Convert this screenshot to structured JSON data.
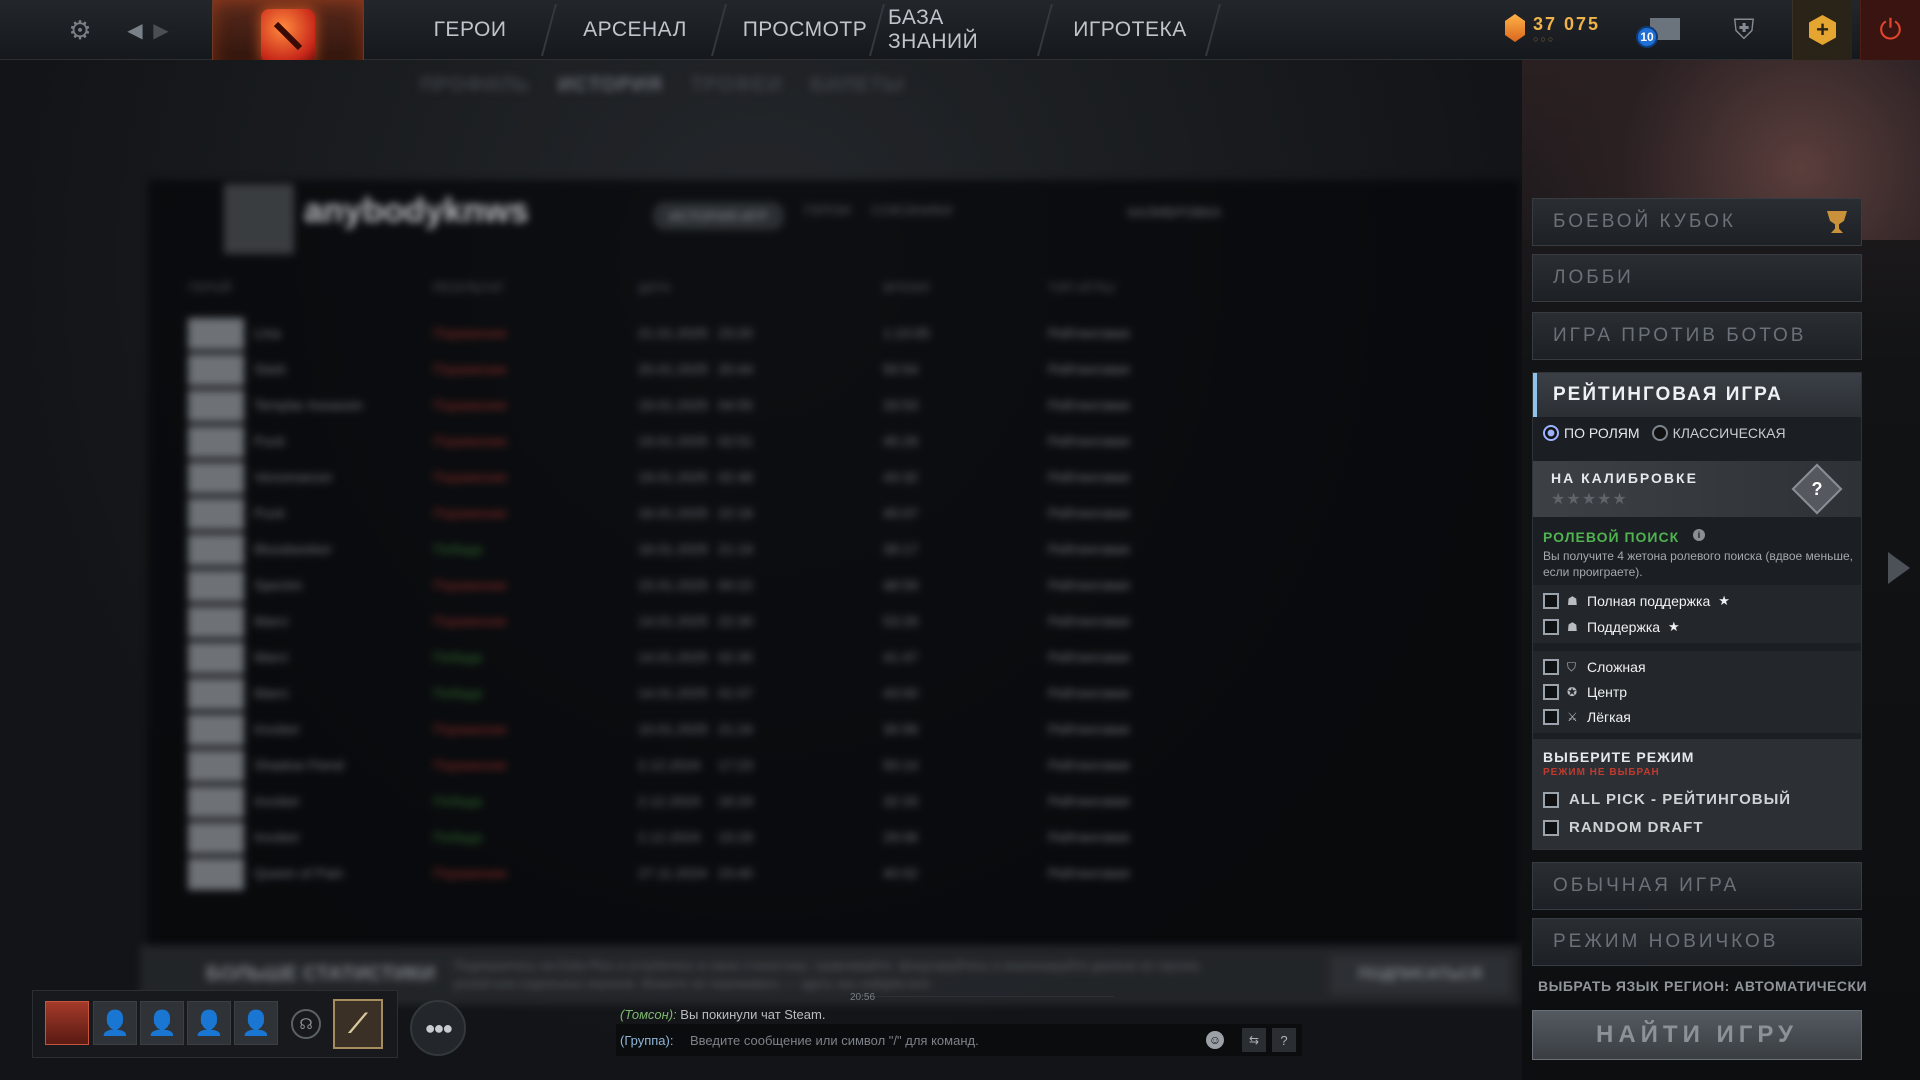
{
  "nav": {
    "heroes": "ГЕРОИ",
    "arsenal": "АРСЕНАЛ",
    "view": "ПРОСМОТР",
    "knowledge": "БАЗА ЗНАНИЙ",
    "arcade": "ИГРОТЕКА"
  },
  "currency": {
    "amount": "37 075",
    "dots": "○○○"
  },
  "mail": {
    "count": "10"
  },
  "profile": {
    "subnav": [
      "ПРОФИЛЬ",
      "ИСТОРИЯ",
      "ТРОФЕИ",
      "БИЛЕТЫ"
    ],
    "name": "anybodyknws",
    "tabs": [
      "ИСТОРИЯ ИГР",
      "ГЕРОИ",
      "СОЮЗНИКИ"
    ],
    "calibration_label": "КАЛИБРОВКА",
    "columns": [
      "ГЕРОЙ",
      "РЕЗУЛЬТАТ",
      "ДАТА",
      "ВРЕМЯ",
      "ТИП ИГРЫ"
    ],
    "matches": [
      {
        "hero": "Lina",
        "result": "Поражение",
        "date": "21.01.2025",
        "time": "23:20",
        "duration": "1:10:05",
        "type": "Рейтинговая",
        "win": false
      },
      {
        "hero": "Slark",
        "result": "Поражение",
        "date": "20.01.2025",
        "time": "20:44",
        "duration": "50:54",
        "type": "Рейтинговая",
        "win": false
      },
      {
        "hero": "Templar Assassin",
        "result": "Поражение",
        "date": "19.01.2025",
        "time": "04:55",
        "duration": "33:53",
        "type": "Рейтинговая",
        "win": false
      },
      {
        "hero": "Puck",
        "result": "Поражение",
        "date": "19.01.2025",
        "time": "02:51",
        "duration": "45:29",
        "type": "Рейтинговая",
        "win": false
      },
      {
        "hero": "Venomancer",
        "result": "Поражение",
        "date": "19.01.2025",
        "time": "02:48",
        "duration": "43:32",
        "type": "Рейтинговая",
        "win": false
      },
      {
        "hero": "Puck",
        "result": "Поражение",
        "date": "16.01.2025",
        "time": "22:16",
        "duration": "45:07",
        "type": "Рейтинговая",
        "win": false
      },
      {
        "hero": "Bloodseeker",
        "result": "Победа",
        "date": "16.01.2025",
        "time": "21:19",
        "duration": "39:17",
        "type": "Рейтинговая",
        "win": true
      },
      {
        "hero": "Spectre",
        "result": "Поражение",
        "date": "15.01.2025",
        "time": "00:22",
        "duration": "48:59",
        "type": "Рейтинговая",
        "win": false
      },
      {
        "hero": "Marci",
        "result": "Поражение",
        "date": "14.01.2025",
        "time": "22:30",
        "duration": "53:29",
        "type": "Рейтинговая",
        "win": false
      },
      {
        "hero": "Marci",
        "result": "Победа",
        "date": "14.01.2025",
        "time": "02:35",
        "duration": "41:47",
        "type": "Рейтинговая",
        "win": true
      },
      {
        "hero": "Marci",
        "result": "Победа",
        "date": "14.01.2025",
        "time": "01:07",
        "duration": "43:00",
        "type": "Рейтинговая",
        "win": true
      },
      {
        "hero": "Invoker",
        "result": "Поражение",
        "date": "10.01.2025",
        "time": "21:24",
        "duration": "30:56",
        "type": "Рейтинговая",
        "win": false
      },
      {
        "hero": "Shadow Fiend",
        "result": "Поражение",
        "date": "2.12.2024",
        "time": "17:23",
        "duration": "50:14",
        "type": "Рейтинговая",
        "win": false
      },
      {
        "hero": "Invoker",
        "result": "Победа",
        "date": "2.12.2024",
        "time": "16:24",
        "duration": "32:33",
        "type": "Рейтинговая",
        "win": true
      },
      {
        "hero": "Invoker",
        "result": "Победа",
        "date": "2.12.2024",
        "time": "15:29",
        "duration": "29:06",
        "type": "Рейтинговая",
        "win": true
      },
      {
        "hero": "Queen of Pain",
        "result": "Поражение",
        "date": "27.11.2024",
        "time": "23:40",
        "duration": "40:02",
        "type": "Рейтинговая",
        "win": false
      }
    ],
    "more_stats": {
      "title": "БОЛЬШЕ СТАТИСТИКИ",
      "text": "Подпишитесь на Dota Plus и углубитесь в свою статистику: сравнивайте, фокусируйтесь и анализируйте данные из героев, ролей или отдельных игроков. Можете не переживать — здесь мы найдём всё.",
      "button": "ПОДПИСАТЬСЯ"
    }
  },
  "play": {
    "battle_cup": "БОЕВОЙ КУБОК",
    "lobby": "ЛОББИ",
    "bots": "ИГРА ПРОТИВ БОТОВ",
    "ranked": {
      "title": "РЕЙТИНГОВАЯ ИГРА",
      "queue_roles": "ПО РОЛЯМ",
      "queue_classic": "КЛАССИЧЕСКАЯ",
      "calibration_title": "НА КАЛИБРОВКЕ",
      "calibration_stars": "★★★★★",
      "medal_symbol": "?",
      "role_search_title": "РОЛЕВОЙ ПОИСК",
      "role_search_desc": "Вы получите 4 жетона ролевого поиска (вдвое меньше, если проиграете).",
      "roles": [
        {
          "label": "Полная поддержка",
          "star": true,
          "icon": "hard-support-icon"
        },
        {
          "label": "Поддержка",
          "star": true,
          "icon": "soft-support-icon"
        },
        {
          "label": "Сложная",
          "star": false,
          "icon": "offlane-icon"
        },
        {
          "label": "Центр",
          "star": false,
          "icon": "mid-icon"
        },
        {
          "label": "Лёгкая",
          "star": false,
          "icon": "carry-icon"
        }
      ],
      "mode_title": "ВЫБЕРИТЕ РЕЖИМ",
      "mode_warning": "РЕЖИМ НЕ ВЫБРАН",
      "mode_allpick": "ALL PICK - РЕЙТИНГОВЫЙ",
      "mode_random": "RANDOM DRAFT"
    },
    "normal": "ОБЫЧНАЯ ИГРА",
    "newbie": "РЕЖИМ НОВИЧКОВ",
    "language": "ВЫБРАТЬ ЯЗЫК",
    "region": "РЕГИОН: АВТОМАТИЧЕСКИ",
    "find_game": "НАЙТИ ИГРУ"
  },
  "chat": {
    "time": "20:56",
    "message_author": "(Томсон):",
    "message_text": " Вы покинули чат Steam.",
    "channel": "(Группа):",
    "placeholder": "Введите сообщение или символ \"/\" для команд."
  },
  "colors": {
    "accent_blue": "#8fc3ea",
    "role_search_green": "#4fb34f",
    "warning_red": "#c23a2e",
    "gold": "#f0b24a"
  }
}
